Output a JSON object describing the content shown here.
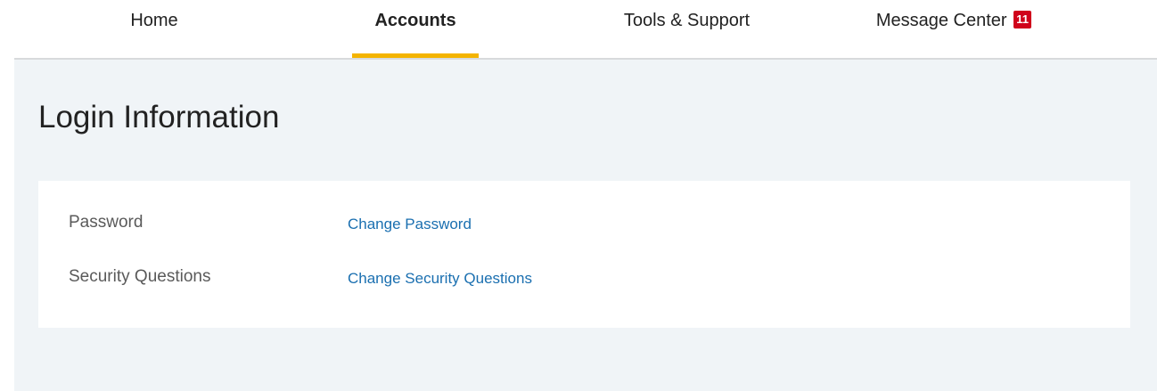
{
  "nav": {
    "items": [
      {
        "label": "Home"
      },
      {
        "label": "Accounts"
      },
      {
        "label": "Tools & Support"
      },
      {
        "label": "Message Center",
        "badge": "11"
      }
    ],
    "active": "Accounts",
    "accent_color": "#f4b400",
    "badge_color": "#d0021b"
  },
  "page": {
    "title": "Login Information"
  },
  "settings": {
    "rows": [
      {
        "label": "Password",
        "link": "Change Password"
      },
      {
        "label": "Security Questions",
        "link": "Change Security Questions"
      }
    ],
    "link_color": "#1a6fb0"
  }
}
